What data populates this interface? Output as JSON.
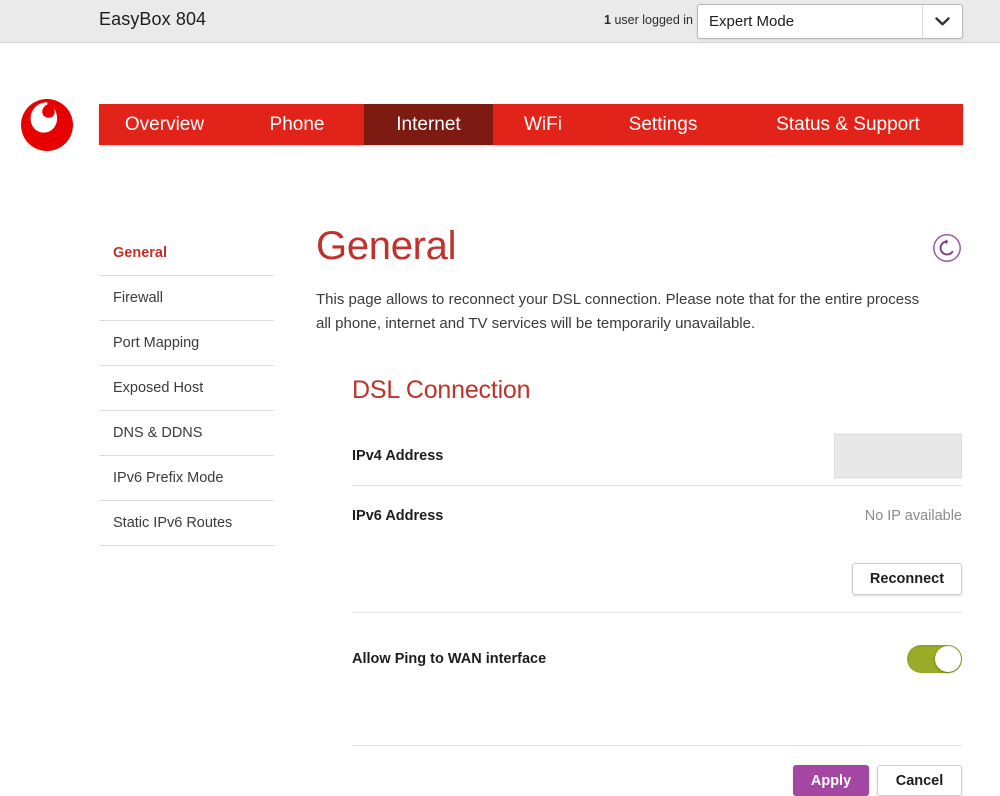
{
  "topbar": {
    "device_title": "EasyBox 804",
    "user_count": "1",
    "user_text": "user logged in",
    "mode_value": "Expert Mode",
    "mode_options": [
      "Expert Mode"
    ],
    "dropdown_icon": "chevron-down-icon"
  },
  "brand": {
    "logo_name": "vodafone-logo",
    "nav_bg": "#e2231a",
    "nav_active_bg": "#7d1a12"
  },
  "nav": {
    "items": [
      {
        "label": "Overview",
        "active": false
      },
      {
        "label": "Phone",
        "active": false
      },
      {
        "label": "Internet",
        "active": true
      },
      {
        "label": "WiFi",
        "active": false
      },
      {
        "label": "Settings",
        "active": false
      },
      {
        "label": "Status & Support",
        "active": false
      }
    ]
  },
  "sidebar": {
    "items": [
      {
        "label": "General",
        "active": true
      },
      {
        "label": "Firewall",
        "active": false
      },
      {
        "label": "Port Mapping",
        "active": false
      },
      {
        "label": "Exposed Host",
        "active": false
      },
      {
        "label": "DNS & DDNS",
        "active": false
      },
      {
        "label": "IPv6 Prefix Mode",
        "active": false
      },
      {
        "label": "Static IPv6 Routes",
        "active": false
      }
    ]
  },
  "content": {
    "title": "General",
    "help_icon": "reload-help-icon",
    "intro": "This page allows to reconnect your DSL connection. Please note that for the entire process all phone, internet and TV services will be temporarily unavailable.",
    "section_title": "DSL Connection",
    "rows": {
      "ipv4_label": "IPv4 Address",
      "ipv4_value": "",
      "ipv6_label": "IPv6 Address",
      "ipv6_value": "No IP available",
      "reconnect_label": "Reconnect",
      "ping_label": "Allow Ping to WAN interface",
      "ping_enabled": "on"
    }
  },
  "footer": {
    "apply_label": "Apply",
    "cancel_label": "Cancel"
  },
  "colors": {
    "brand_red": "#e2231a",
    "heading_red": "#c0322b",
    "active_nav": "#7d1a12",
    "apply_purple": "#a347a3",
    "toggle_green": "#9aab28",
    "topbar_gray": "#eaeaea"
  }
}
